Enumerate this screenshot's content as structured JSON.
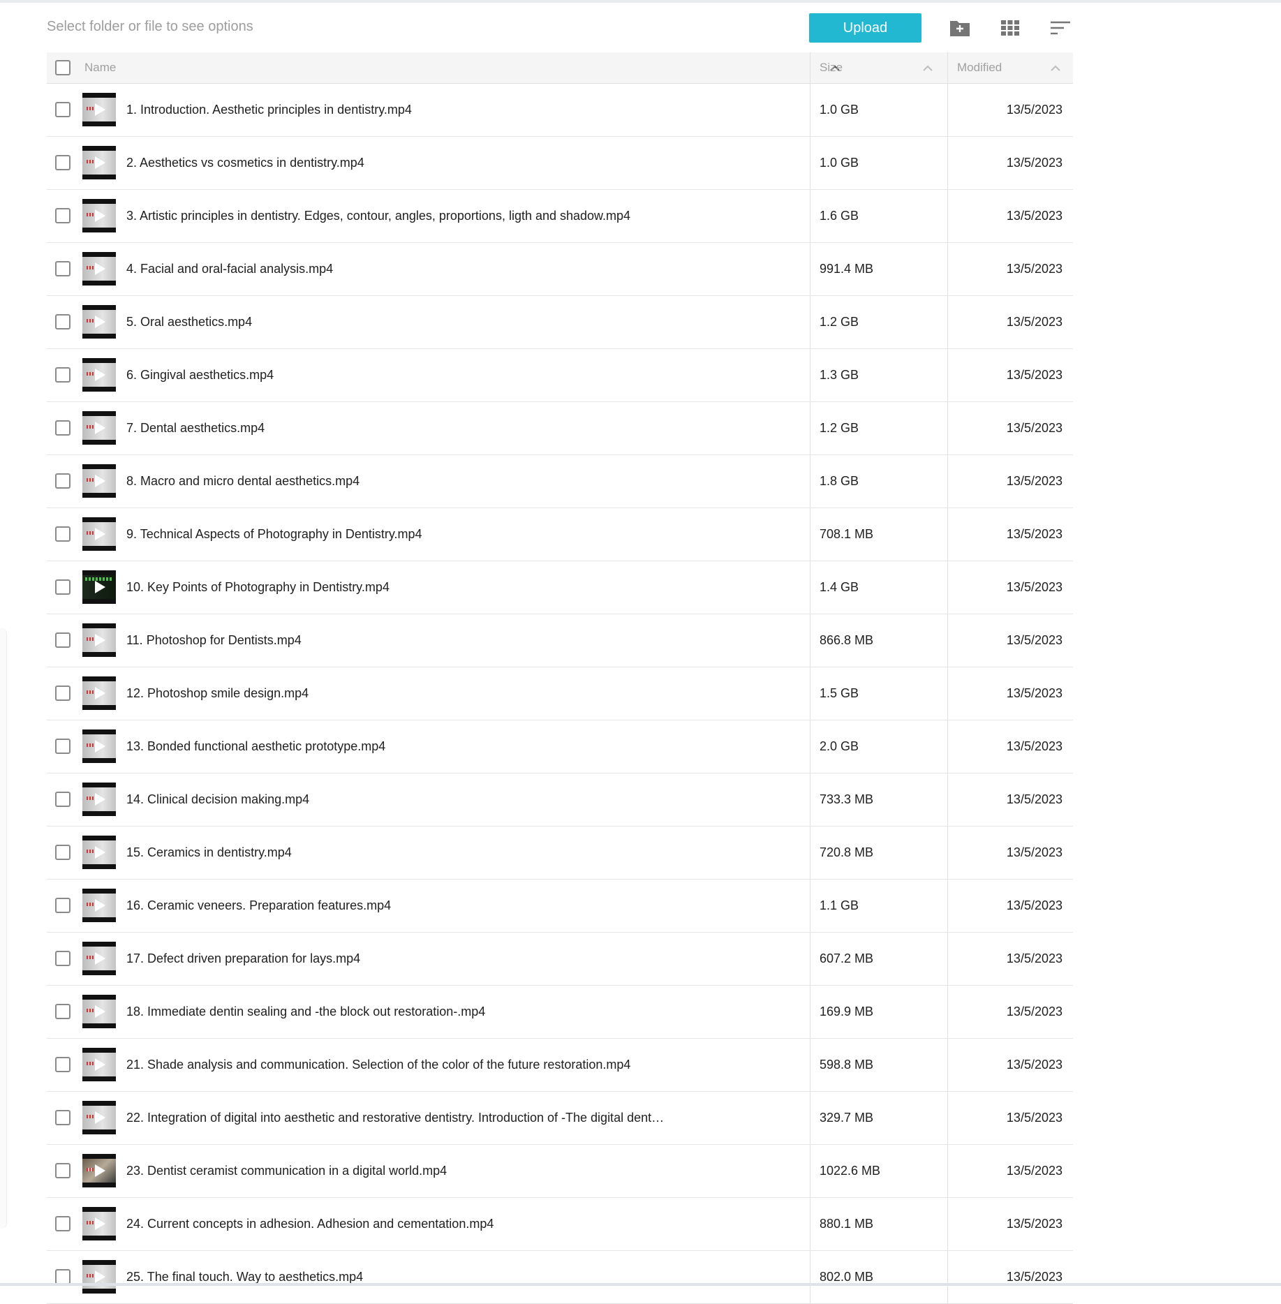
{
  "toolbar": {
    "hint": "Select folder or file to see options",
    "upload_label": "Upload",
    "icons": [
      "new-folder-icon",
      "grid-view-icon",
      "sort-icon"
    ]
  },
  "colors": {
    "accent": "#22b8d2",
    "header_bg": "#f5f5f5",
    "header_text": "#a0a0a0",
    "divider": "#e0e0e0"
  },
  "table": {
    "columns": {
      "name": "Name",
      "size": "Size",
      "modified": "Modified"
    },
    "rows": [
      {
        "name": "1. Introduction. Aesthetic principles in dentistry.mp4",
        "size": "1.0 GB",
        "modified": "13/5/2023",
        "thumb": "standard"
      },
      {
        "name": "2. Aesthetics vs cosmetics in dentistry.mp4",
        "size": "1.0 GB",
        "modified": "13/5/2023",
        "thumb": "standard"
      },
      {
        "name": "3. Artistic principles in dentistry. Edges, contour, angles, proportions, ligth and shadow.mp4",
        "size": "1.6 GB",
        "modified": "13/5/2023",
        "thumb": "standard"
      },
      {
        "name": "4. Facial and oral-facial analysis.mp4",
        "size": "991.4 MB",
        "modified": "13/5/2023",
        "thumb": "standard"
      },
      {
        "name": "5. Oral aesthetics.mp4",
        "size": "1.2 GB",
        "modified": "13/5/2023",
        "thumb": "standard"
      },
      {
        "name": "6. Gingival aesthetics.mp4",
        "size": "1.3 GB",
        "modified": "13/5/2023",
        "thumb": "standard"
      },
      {
        "name": "7. Dental aesthetics.mp4",
        "size": "1.2 GB",
        "modified": "13/5/2023",
        "thumb": "standard"
      },
      {
        "name": "8. Macro and micro dental aesthetics.mp4",
        "size": "1.8 GB",
        "modified": "13/5/2023",
        "thumb": "standard"
      },
      {
        "name": "9. Technical Aspects of Photography in Dentistry.mp4",
        "size": "708.1 MB",
        "modified": "13/5/2023",
        "thumb": "standard"
      },
      {
        "name": "10. Key Points of Photography in Dentistry.mp4",
        "size": "1.4 GB",
        "modified": "13/5/2023",
        "thumb": "dark"
      },
      {
        "name": "11. Photoshop for Dentists.mp4",
        "size": "866.8 MB",
        "modified": "13/5/2023",
        "thumb": "standard"
      },
      {
        "name": "12. Photoshop smile design.mp4",
        "size": "1.5 GB",
        "modified": "13/5/2023",
        "thumb": "standard"
      },
      {
        "name": "13. Bonded functional aesthetic prototype.mp4",
        "size": "2.0 GB",
        "modified": "13/5/2023",
        "thumb": "standard"
      },
      {
        "name": "14. Clinical decision making.mp4",
        "size": "733.3 MB",
        "modified": "13/5/2023",
        "thumb": "standard"
      },
      {
        "name": "15. Ceramics in dentistry.mp4",
        "size": "720.8 MB",
        "modified": "13/5/2023",
        "thumb": "standard"
      },
      {
        "name": "16. Ceramic veneers. Preparation features.mp4",
        "size": "1.1 GB",
        "modified": "13/5/2023",
        "thumb": "standard"
      },
      {
        "name": "17. Defect driven preparation for lays.mp4",
        "size": "607.2 MB",
        "modified": "13/5/2023",
        "thumb": "standard"
      },
      {
        "name": "18. Immediate dentin sealing and -the block out restoration-.mp4",
        "size": "169.9 MB",
        "modified": "13/5/2023",
        "thumb": "standard"
      },
      {
        "name": "21. Shade analysis and communication. Selection of the color of the future restoration.mp4",
        "size": "598.8 MB",
        "modified": "13/5/2023",
        "thumb": "standard"
      },
      {
        "name": "22. Integration of digital into aesthetic and restorative dentistry. Introduction of -The digital dent…",
        "size": "329.7 MB",
        "modified": "13/5/2023",
        "thumb": "standard"
      },
      {
        "name": "23. Dentist ceramist communication in a digital world.mp4",
        "size": "1022.6 MB",
        "modified": "13/5/2023",
        "thumb": "mixed"
      },
      {
        "name": "24. Current concepts in adhesion. Adhesion and cementation.mp4",
        "size": "880.1 MB",
        "modified": "13/5/2023",
        "thumb": "standard"
      },
      {
        "name": "25. The final touch. Way to aesthetics.mp4",
        "size": "802.0 MB",
        "modified": "13/5/2023",
        "thumb": "standard"
      }
    ]
  }
}
